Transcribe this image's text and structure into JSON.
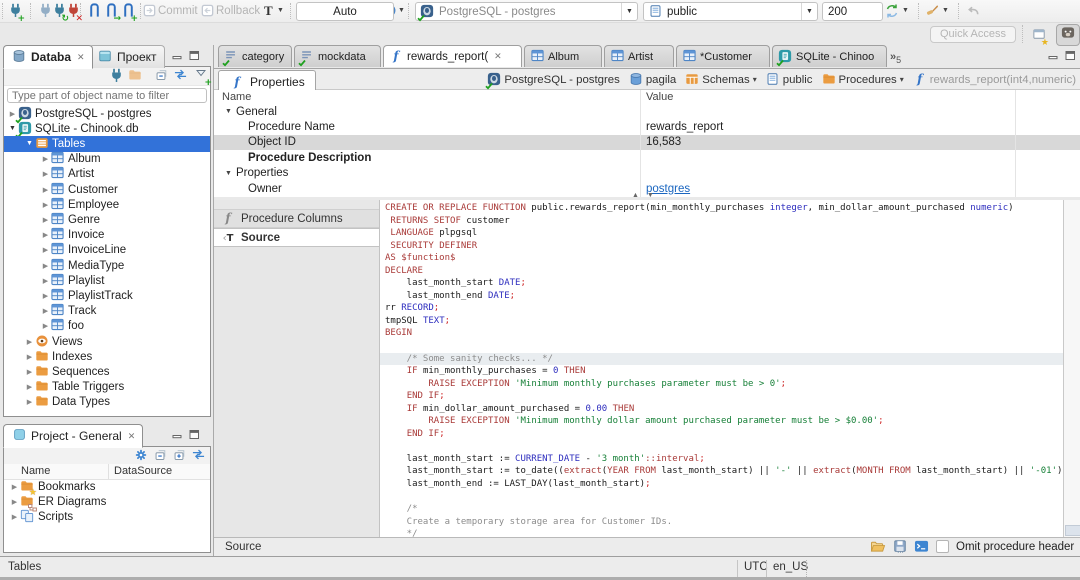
{
  "toolbar": {
    "auto_commit": "Auto",
    "commit_label": "Commit",
    "rollback_label": "Rollback",
    "connection_combo": "PostgreSQL - postgres",
    "schema_combo": "public",
    "result_limit": "200",
    "quick_access_label": "Quick Access"
  },
  "navigator": {
    "tab_database": "Databa",
    "tab_project": "Проект",
    "filter_placeholder": "Type part of object name to filter",
    "tree": [
      {
        "label": "PostgreSQL - postgres",
        "icon": "postgres-db",
        "level": 0,
        "state": "collapsed"
      },
      {
        "label": "SQLite - Chinook.db",
        "icon": "sqlite-db",
        "level": 0,
        "state": "expanded"
      },
      {
        "label": "Tables",
        "icon": "tables-folder",
        "level": 1,
        "state": "expanded",
        "selected": true
      },
      {
        "label": "Album",
        "icon": "table",
        "level": 2,
        "state": "collapsed"
      },
      {
        "label": "Artist",
        "icon": "table",
        "level": 2,
        "state": "collapsed"
      },
      {
        "label": "Customer",
        "icon": "table",
        "level": 2,
        "state": "collapsed"
      },
      {
        "label": "Employee",
        "icon": "table",
        "level": 2,
        "state": "collapsed"
      },
      {
        "label": "Genre",
        "icon": "table",
        "level": 2,
        "state": "collapsed"
      },
      {
        "label": "Invoice",
        "icon": "table",
        "level": 2,
        "state": "collapsed"
      },
      {
        "label": "InvoiceLine",
        "icon": "table",
        "level": 2,
        "state": "collapsed"
      },
      {
        "label": "MediaType",
        "icon": "table",
        "level": 2,
        "state": "collapsed"
      },
      {
        "label": "Playlist",
        "icon": "table",
        "level": 2,
        "state": "collapsed"
      },
      {
        "label": "PlaylistTrack",
        "icon": "table",
        "level": 2,
        "state": "collapsed"
      },
      {
        "label": "Track",
        "icon": "table",
        "level": 2,
        "state": "collapsed"
      },
      {
        "label": "foo",
        "icon": "table",
        "level": 2,
        "state": "collapsed"
      },
      {
        "label": "Views",
        "icon": "views",
        "level": 1,
        "state": "collapsed"
      },
      {
        "label": "Indexes",
        "icon": "folder",
        "level": 1,
        "state": "collapsed"
      },
      {
        "label": "Sequences",
        "icon": "folder",
        "level": 1,
        "state": "collapsed"
      },
      {
        "label": "Table Triggers",
        "icon": "folder",
        "level": 1,
        "state": "collapsed"
      },
      {
        "label": "Data Types",
        "icon": "folder",
        "level": 1,
        "state": "collapsed"
      }
    ]
  },
  "project": {
    "tab_label": "Project - General",
    "columns": [
      "Name",
      "DataSource"
    ],
    "items": [
      {
        "label": "Bookmarks",
        "icon": "bookmarks"
      },
      {
        "label": "ER Diagrams",
        "icon": "er-diagrams"
      },
      {
        "label": "Scripts",
        "icon": "scripts"
      }
    ]
  },
  "editor": {
    "tabs": [
      {
        "label": "category",
        "icon": "sql-script"
      },
      {
        "label": "mockdata",
        "icon": "sql-script"
      },
      {
        "label": "rewards_report(",
        "icon": "function",
        "active": true,
        "closable": true
      },
      {
        "label": "Album",
        "icon": "table"
      },
      {
        "label": "Artist",
        "icon": "table"
      },
      {
        "label": "*Customer",
        "icon": "table"
      },
      {
        "label": "SQLite - Chinoo",
        "icon": "sqlite-db"
      }
    ],
    "overflow_count": "5",
    "properties_tab": "Properties",
    "breadcrumbs": [
      {
        "label": "PostgreSQL - postgres",
        "icon": "postgres-db"
      },
      {
        "label": "pagila",
        "icon": "database"
      },
      {
        "label": "Schemas",
        "icon": "schemas",
        "dropdown": true
      },
      {
        "label": "public",
        "icon": "schema"
      },
      {
        "label": "Procedures",
        "icon": "folder",
        "dropdown": true
      },
      {
        "label": "rewards_report(int4,numeric)",
        "icon": "function",
        "muted": true
      }
    ],
    "properties": {
      "columns": [
        "Name",
        "Value"
      ],
      "rows": [
        {
          "name": "General",
          "type": "group"
        },
        {
          "name": "Procedure Name",
          "value": "rewards_report"
        },
        {
          "name": "Object ID",
          "value": "16,583",
          "selected": true
        },
        {
          "name": "Procedure Description",
          "bold": true,
          "value": ""
        },
        {
          "name": "Properties",
          "type": "group"
        },
        {
          "name": "Owner",
          "value": "postgres",
          "link": true
        }
      ]
    },
    "side_tabs": [
      {
        "label": "Procedure Columns",
        "icon": "function-gray"
      },
      {
        "label": "Source",
        "icon": "source",
        "active": true
      }
    ],
    "bottom_label": "Source",
    "omit_header_label": "Omit procedure header"
  },
  "code": {
    "lines": [
      {
        "hl": false,
        "t": [
          [
            "k",
            "CREATE OR REPLACE FUNCTION"
          ],
          [
            "p",
            " public.rewards_report(min_monthly_purchases "
          ],
          [
            "t",
            "integer"
          ],
          [
            "p",
            ", min_dollar_amount_purchased "
          ],
          [
            "t",
            "numeric"
          ],
          [
            "p",
            ")"
          ]
        ]
      },
      {
        "hl": false,
        "t": [
          [
            "p",
            " "
          ],
          [
            "k",
            "RETURNS SETOF"
          ],
          [
            "p",
            " customer"
          ]
        ]
      },
      {
        "hl": false,
        "t": [
          [
            "p",
            " "
          ],
          [
            "k",
            "LANGUAGE"
          ],
          [
            "p",
            " plpgsql"
          ]
        ]
      },
      {
        "hl": false,
        "t": [
          [
            "p",
            " "
          ],
          [
            "k",
            "SECURITY DEFINER"
          ]
        ]
      },
      {
        "hl": false,
        "t": [
          [
            "k",
            "AS $function$"
          ]
        ]
      },
      {
        "hl": false,
        "t": [
          [
            "k",
            "DECLARE"
          ]
        ]
      },
      {
        "hl": false,
        "t": [
          [
            "p",
            "    last_month_start "
          ],
          [
            "t",
            "DATE"
          ],
          [
            "d",
            ";"
          ]
        ]
      },
      {
        "hl": false,
        "t": [
          [
            "p",
            "    last_month_end "
          ],
          [
            "t",
            "DATE"
          ],
          [
            "d",
            ";"
          ]
        ]
      },
      {
        "hl": false,
        "t": [
          [
            "p",
            "rr "
          ],
          [
            "t",
            "RECORD"
          ],
          [
            "d",
            ";"
          ]
        ]
      },
      {
        "hl": false,
        "t": [
          [
            "p",
            "tmpSQL "
          ],
          [
            "t",
            "TEXT"
          ],
          [
            "d",
            ";"
          ]
        ]
      },
      {
        "hl": false,
        "t": [
          [
            "k",
            "BEGIN"
          ]
        ]
      },
      {
        "hl": false,
        "t": []
      },
      {
        "hl": true,
        "t": [
          [
            "c",
            "    /* Some sanity checks... */"
          ]
        ]
      },
      {
        "hl": false,
        "t": [
          [
            "p",
            "    "
          ],
          [
            "k",
            "IF"
          ],
          [
            "p",
            " min_monthly_purchases = "
          ],
          [
            "n",
            "0"
          ],
          [
            "p",
            " "
          ],
          [
            "k",
            "THEN"
          ]
        ]
      },
      {
        "hl": false,
        "t": [
          [
            "p",
            "        "
          ],
          [
            "k",
            "RAISE EXCEPTION"
          ],
          [
            "p",
            " "
          ],
          [
            "s",
            "'Minimum monthly purchases parameter must be > 0'"
          ],
          [
            "d",
            ";"
          ]
        ]
      },
      {
        "hl": false,
        "t": [
          [
            "p",
            "    "
          ],
          [
            "k",
            "END IF"
          ],
          [
            "d",
            ";"
          ]
        ]
      },
      {
        "hl": false,
        "t": [
          [
            "p",
            "    "
          ],
          [
            "k",
            "IF"
          ],
          [
            "p",
            " min_dollar_amount_purchased = "
          ],
          [
            "n",
            "0.00"
          ],
          [
            "p",
            " "
          ],
          [
            "k",
            "THEN"
          ]
        ]
      },
      {
        "hl": false,
        "t": [
          [
            "p",
            "        "
          ],
          [
            "k",
            "RAISE EXCEPTION"
          ],
          [
            "p",
            " "
          ],
          [
            "s",
            "'Minimum monthly dollar amount purchased parameter must be > $0.00'"
          ],
          [
            "d",
            ";"
          ]
        ]
      },
      {
        "hl": false,
        "t": [
          [
            "p",
            "    "
          ],
          [
            "k",
            "END IF"
          ],
          [
            "d",
            ";"
          ]
        ]
      },
      {
        "hl": false,
        "t": []
      },
      {
        "hl": false,
        "t": [
          [
            "p",
            "    last_month_start := "
          ],
          [
            "t",
            "CURRENT_DATE"
          ],
          [
            "p",
            " - "
          ],
          [
            "s",
            "'3 month'"
          ],
          [
            "k",
            "::interval"
          ],
          [
            "d",
            ";"
          ]
        ]
      },
      {
        "hl": false,
        "t": [
          [
            "p",
            "    last_month_start := to_date(("
          ],
          [
            "k",
            "extract"
          ],
          [
            "p",
            "("
          ],
          [
            "k",
            "YEAR FROM"
          ],
          [
            "p",
            " last_month_start) || "
          ],
          [
            "s",
            "'-'"
          ],
          [
            "p",
            " || "
          ],
          [
            "k",
            "extract"
          ],
          [
            "p",
            "("
          ],
          [
            "k",
            "MONTH FROM"
          ],
          [
            "p",
            " last_month_start) || "
          ],
          [
            "s",
            "'-01'"
          ],
          [
            "p",
            ")"
          ]
        ]
      },
      {
        "hl": false,
        "t": [
          [
            "p",
            "    last_month_end := LAST_DAY(last_month_start)"
          ],
          [
            "d",
            ";"
          ]
        ]
      },
      {
        "hl": false,
        "t": []
      },
      {
        "hl": false,
        "t": [
          [
            "c",
            "    /*"
          ]
        ]
      },
      {
        "hl": false,
        "t": [
          [
            "c",
            "    Create a temporary storage area for Customer IDs."
          ]
        ]
      },
      {
        "hl": false,
        "t": [
          [
            "c",
            "    */"
          ]
        ]
      }
    ]
  },
  "statusbar": {
    "left": "Tables",
    "timezone": "UTC",
    "locale": "en_US"
  }
}
